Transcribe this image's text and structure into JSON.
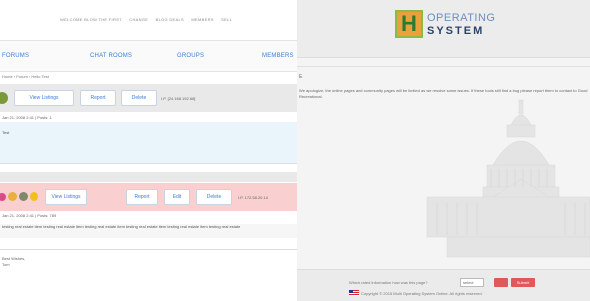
{
  "left": {
    "top_links": [
      "WELCOME BLOW THE FIRST",
      "CHANGE",
      "BLOG DEALS",
      "MEMBERS",
      "SELL"
    ],
    "nav": [
      "FORUMS",
      "CHAT ROOMS",
      "GROUPS",
      "MEMBERS"
    ],
    "breadcrumb": "Home › Forum › Hello Test",
    "post1": {
      "buttons": [
        "View Listings",
        "Report",
        "Delete"
      ],
      "ip": "I.P. [24.168.192.68]",
      "meta": "Jan 21, 2008 2:41 | Posts: 1",
      "body": "Test"
    },
    "post2": {
      "buttons": [
        "View Listings",
        "Report",
        "Edit",
        "Delete"
      ],
      "ip": "I.P. 172.58.20.14",
      "meta": "Jan 21, 2008 2:41 | Posts: 789",
      "text": "testing real estate item testing real estate item testing real estate item testing real estate item testing real estate item testing real estate",
      "sig": [
        "Best Wishes,",
        "Tom"
      ]
    }
  },
  "right": {
    "logo_top": "OPERATING",
    "logo_bottom": "SYSTEM",
    "logo_letter": "H",
    "intro": "E",
    "message": "We apologize, the online pages and community pages will be limited as we resolve some issues. If these tools still find a bug please report them to contact to Good Recreational.",
    "footer_question": "Which rated information how was this page?",
    "select_value": "select",
    "btn1": "",
    "btn2": "Submit",
    "copyright": "Copyright © 2015 Multi Operating System Online. All rights reserved."
  },
  "colors": {
    "accent": "#3b7dd8",
    "post2_bg": "#f9cfcf",
    "post_body_bg": "#eaf5fb",
    "logo_orange": "#e8a13c",
    "logo_green": "#2e7a2e",
    "footer_btn": "#e0585a"
  }
}
